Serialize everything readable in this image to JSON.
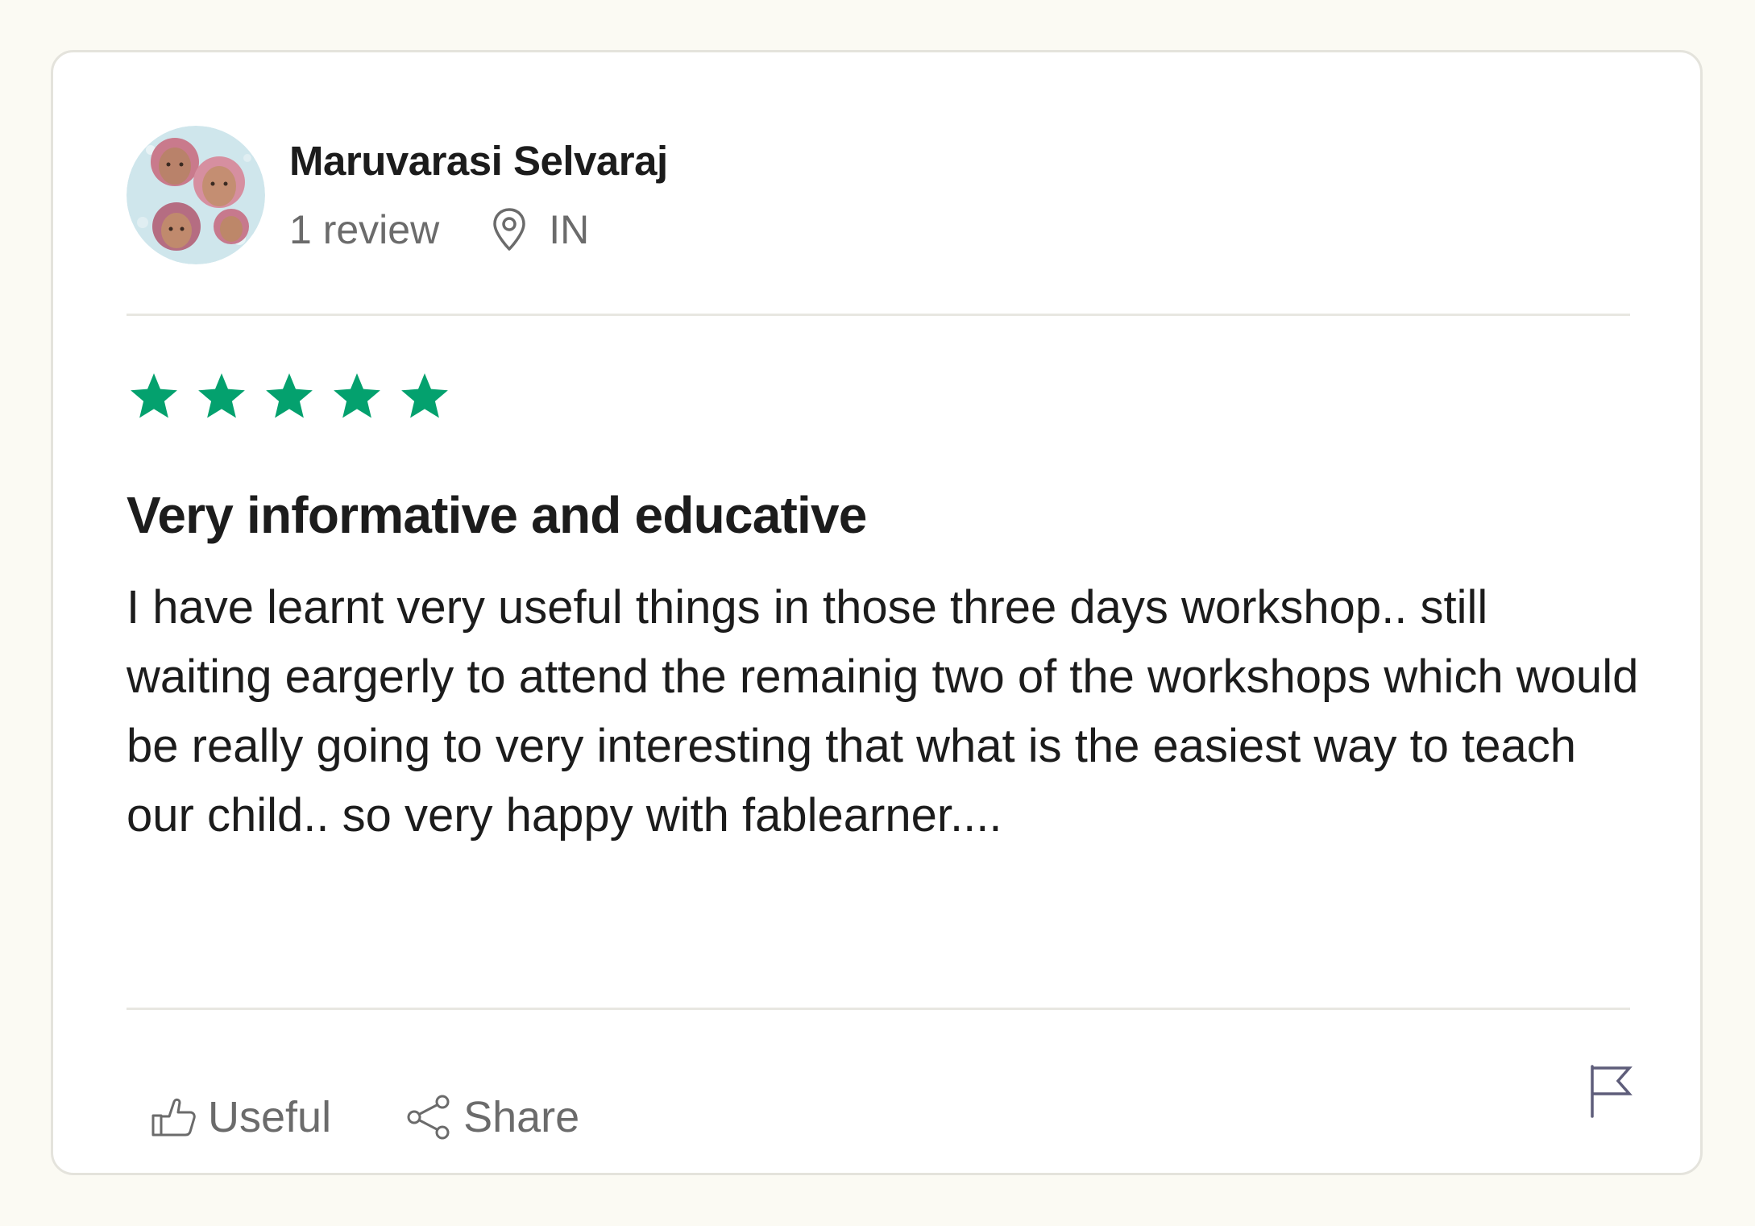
{
  "reviewer": {
    "name": "Maruvarasi Selvaraj",
    "review_count": "1 review",
    "country": "IN",
    "avatar_icon": "profile-photo"
  },
  "review": {
    "rating": 5,
    "max_rating": 5,
    "title": "Very informative and educative",
    "body": "I have learnt very useful things in those three days workshop.. still waiting eargerly to attend the remainig two of the workshops which would be really going to very interesting that what is the easiest way to teach our child.. so very happy with fablearner...."
  },
  "actions": {
    "useful_label": "Useful",
    "share_label": "Share",
    "useful_icon": "thumbs-up-icon",
    "share_icon": "share-icon",
    "report_icon": "flag-icon"
  },
  "colors": {
    "star": "#04a16e",
    "page_background": "#fbfaf3",
    "card_background": "#ffffff",
    "text_primary": "#1c1c1c",
    "text_secondary": "#6b6b6b",
    "flag": "#5e5d7a"
  }
}
